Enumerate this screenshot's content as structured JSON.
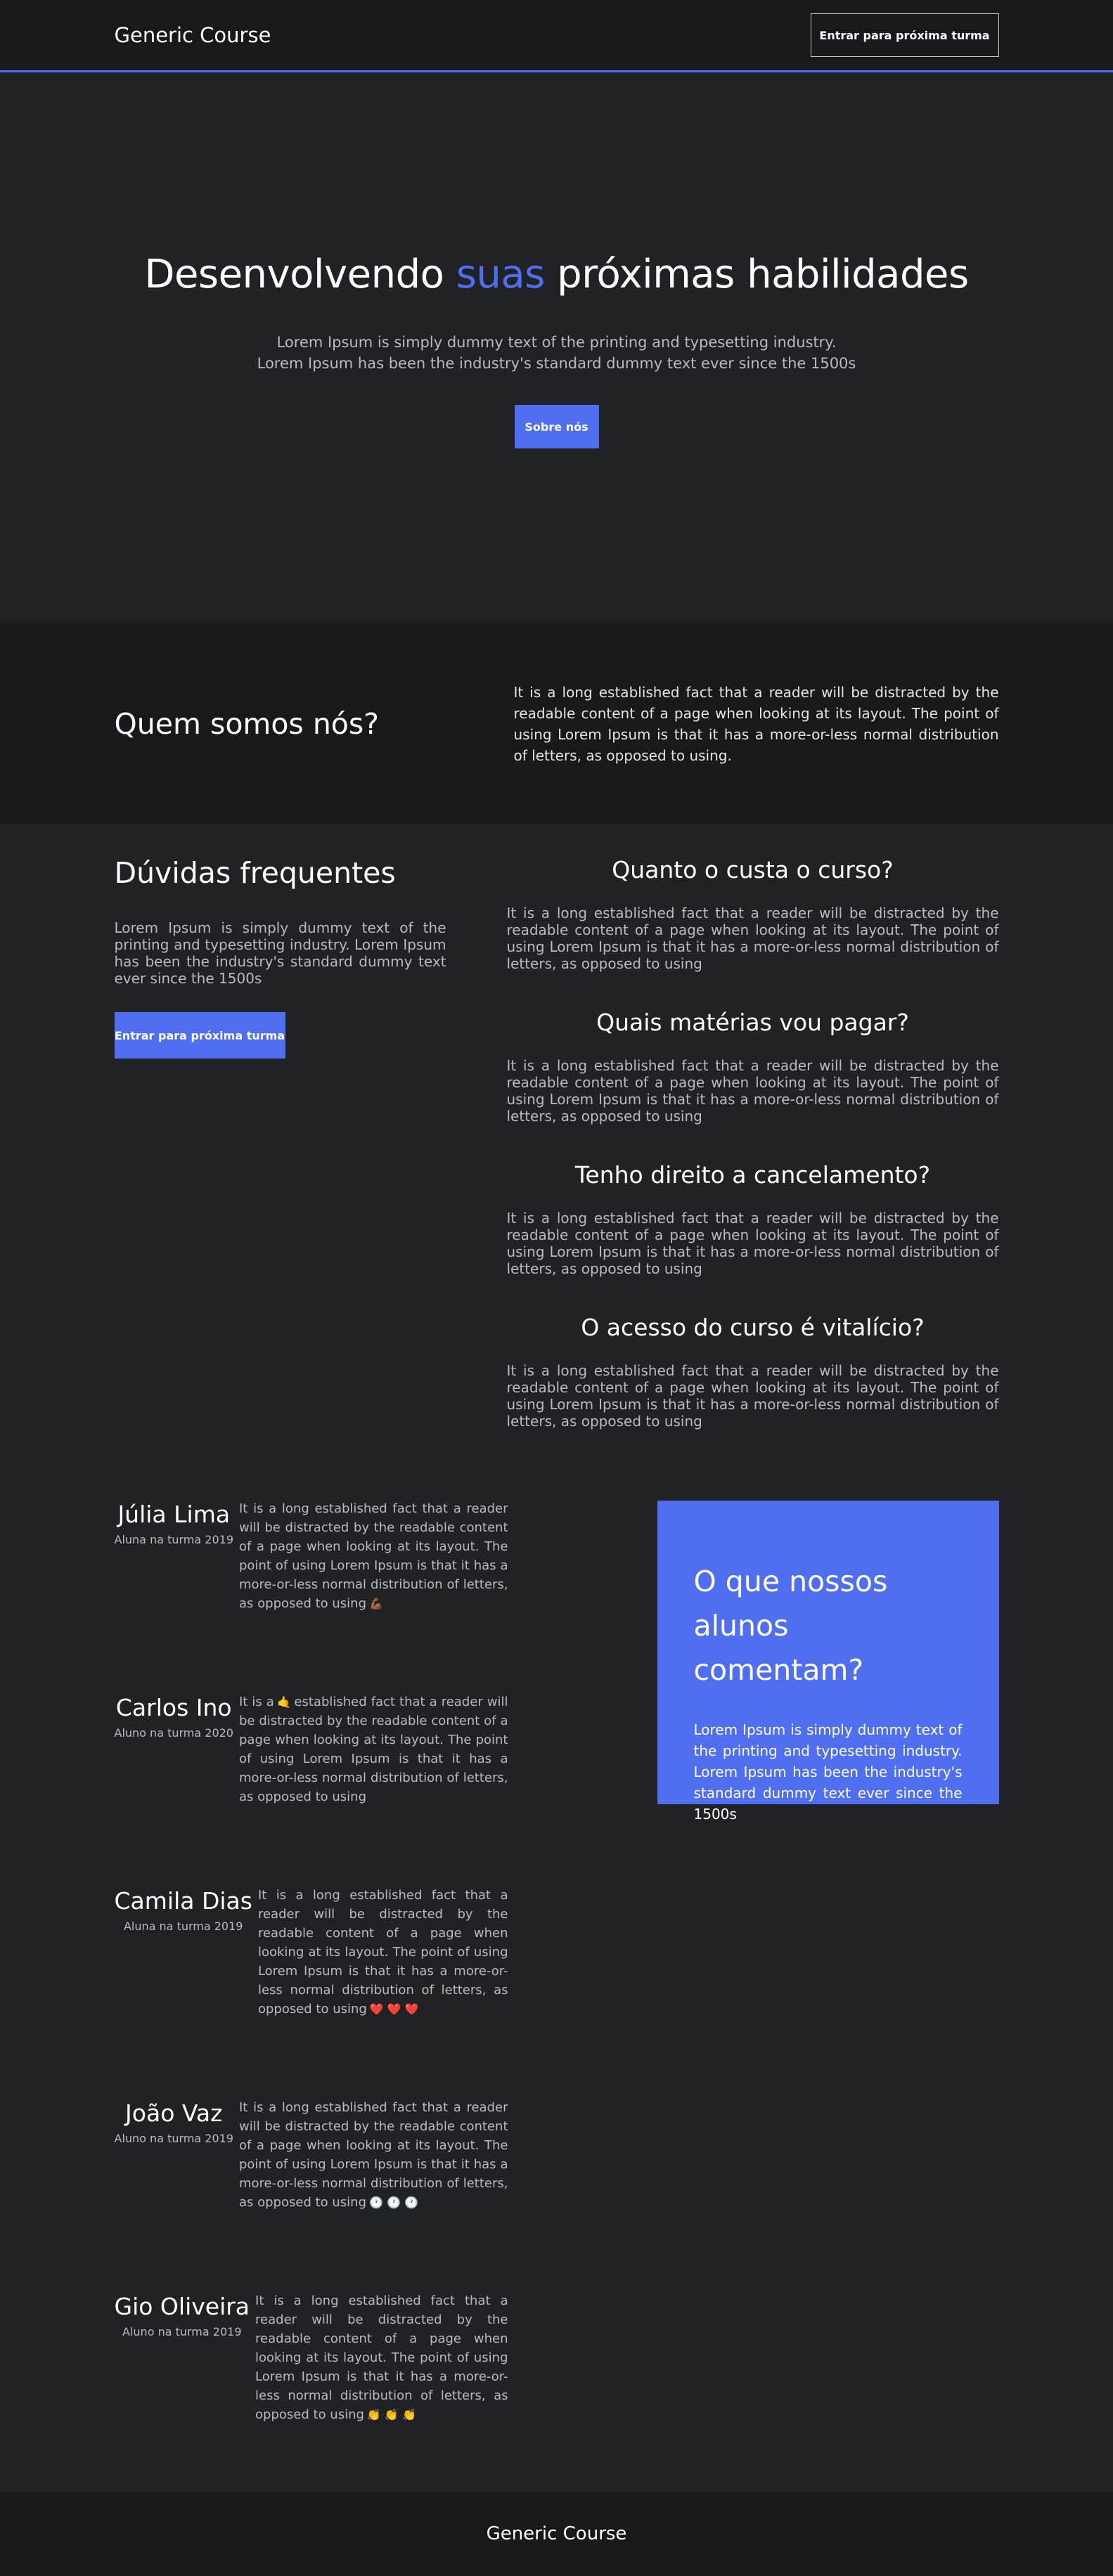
{
  "header": {
    "logo": "Generic Course",
    "cta_label": "Entrar para próxima turma"
  },
  "hero": {
    "title_before": "Desenvolvendo ",
    "title_accent": "suas",
    "title_after": " próximas habilidades",
    "lead_line1": "Lorem Ipsum is simply dummy text of the printing and typesetting industry.",
    "lead_line2": "Lorem Ipsum has been the industry's standard dummy text ever since the 1500s",
    "button_label": "Sobre nós"
  },
  "about": {
    "title": "Quem somos nós?",
    "text": "It is a long established fact that a reader will be distracted by the readable content of a page when looking at its layout. The point of using Lorem Ipsum is that it has a more-or-less normal distribution of letters, as opposed to using."
  },
  "faq": {
    "title": "Dúvidas frequentes",
    "intro": "Lorem Ipsum is simply dummy text of the printing and typesetting industry. Lorem Ipsum has been the industry's standard dummy text ever since the 1500s",
    "button_label": "Entrar para próxima turma",
    "items": [
      {
        "question": "Quanto o custa o curso?",
        "answer": "It is a long established fact that a reader will be distracted by the readable content of a page when looking at its layout. The point of using Lorem Ipsum is that it has a more-or-less normal distribution of letters, as opposed to using"
      },
      {
        "question": "Quais matérias vou pagar?",
        "answer": "It is a long established fact that a reader will be distracted by the readable content of a page when looking at its layout. The point of using Lorem Ipsum is that it has a more-or-less normal distribution of letters, as opposed to using"
      },
      {
        "question": "Tenho direito a cancelamento?",
        "answer": "It is a long established fact that a reader will be distracted by the readable content of a page when looking at its layout. The point of using Lorem Ipsum is that it has a more-or-less normal distribution of letters, as opposed to using"
      },
      {
        "question": "O acesso do curso é vitalício?",
        "answer": "It is a long established fact that a reader will be distracted by the readable content of a page when looking at its layout. The point of using Lorem Ipsum is that it has a more-or-less normal distribution of letters, as opposed to using"
      }
    ]
  },
  "testimonials": {
    "card_title": "O que nossos alunos comentam?",
    "card_text": "Lorem Ipsum is simply dummy text of the printing and typesetting industry. Lorem Ipsum has been the industry's standard dummy text ever since the 1500s",
    "items": [
      {
        "name": "Júlia Lima",
        "cohort": "Aluna na turma 2019",
        "text": "It is a long established fact that a reader will be distracted by the readable content of a page when looking at its layout. The point of using Lorem Ipsum is that it has a more-or-less normal distribution of letters, as opposed to using",
        "emoji": "💪🏾"
      },
      {
        "name": "Carlos Ino",
        "cohort": "Aluno na turma 2020",
        "text_prefix": "It is a",
        "emoji_inline": "🤙",
        "text": "established fact that a reader will be distracted by the readable content of a page when looking at its layout. The point of using Lorem Ipsum is that it has a more-or-less normal distribution of letters, as opposed to using"
      },
      {
        "name": "Camila Dias",
        "cohort": "Aluna na turma 2019",
        "text": "It is a long established fact that a reader will be distracted by the readable content of a page when looking at its layout. The point of using Lorem Ipsum is that it has a more-or-less normal distribution of letters, as opposed to using",
        "emoji": "❤️ ❤️ ❤️"
      },
      {
        "name": "João Vaz",
        "cohort": "Aluno na turma 2019",
        "text": "It is a long established fact that a reader will be distracted by the readable content of a page when looking at its layout. The point of using Lorem Ipsum is that it has a more-or-less normal distribution of letters, as opposed to using",
        "emoji": "🕐 🕐 🕐"
      },
      {
        "name": "Gio Oliveira",
        "cohort": "Aluno na turma 2019",
        "text": "It is a long established fact that a reader will be distracted by the readable content of a page when looking at its layout. The point of using Lorem Ipsum is that it has a more-or-less normal distribution of letters, as opposed to using",
        "emoji": "👏 👏 👏"
      }
    ]
  },
  "footer": {
    "logo": "Generic Course"
  },
  "colors": {
    "accent": "#4f6ef0",
    "background": "#202226",
    "background_dark": "#18191c",
    "muted_text": "#b9bbc2"
  }
}
